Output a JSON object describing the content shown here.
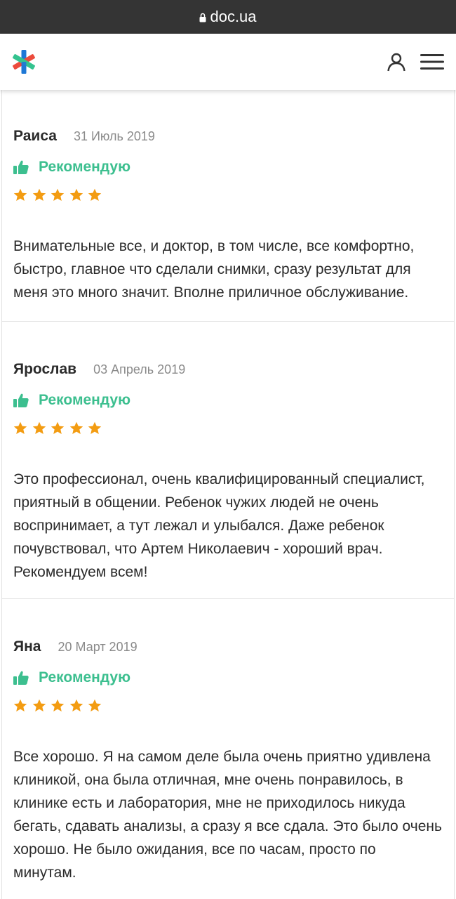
{
  "browser": {
    "url": "doc.ua",
    "lock_icon": "lock-icon"
  },
  "header": {
    "logo_icon": "asterisk-logo-icon",
    "profile_icon": "user-icon",
    "menu_icon": "hamburger-menu-icon"
  },
  "colors": {
    "accent_green": "#3cbf8f",
    "star_orange": "#f39c12",
    "urlbar_bg": "#343434"
  },
  "reviews": [
    {
      "author": "Раиса",
      "date": "31 Июль 2019",
      "recommend": "Рекомендую",
      "rating": 5,
      "text": "Внимательные все, и доктор, в том числе, все комфортно, быстро, главное что сделали снимки, сразу результат для меня это много значит. Вполне приличное обслуживание."
    },
    {
      "author": "Ярослав",
      "date": "03 Апрель 2019",
      "recommend": "Рекомендую",
      "rating": 5,
      "text": "Это профессионал, очень квалифицированный специалист, приятный в общении. Ребенок чужих людей не очень воспринимает, а тут лежал и улыбался. Даже ребенок почувствовал, что Артем Николаевич - хороший врач. Рекомендуем всем!"
    },
    {
      "author": "Яна",
      "date": "20 Март 2019",
      "recommend": "Рекомендую",
      "rating": 5,
      "text": "Все хорошо. Я на самом деле была очень приятно удивлена клиникой, она была отличная, мне очень понравилось, в клинике есть и лаборатория, мне не приходилось никуда бегать, сдавать анализы, а сразу я все сдала. Это было очень хорошо. Не было ожидания, все по часам, просто по минутам."
    }
  ]
}
